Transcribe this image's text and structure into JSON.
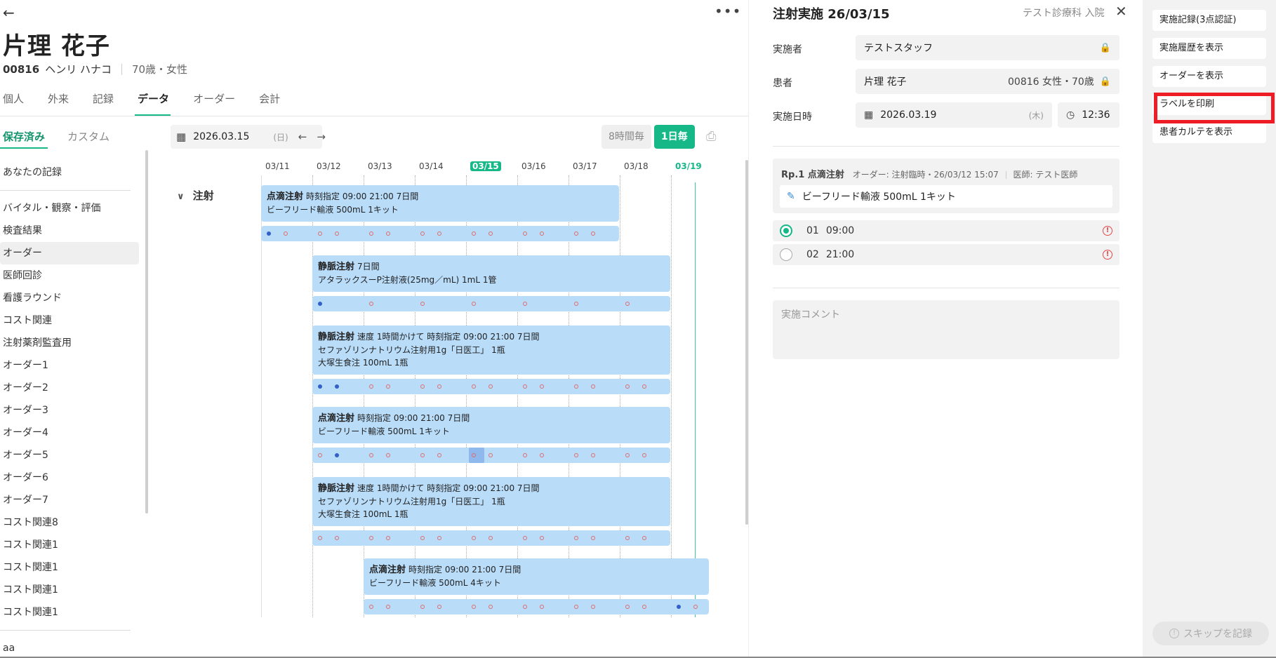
{
  "header": {
    "back": "←",
    "more": "•••",
    "patient_name": "片理 花子",
    "patient_id": "00816",
    "patient_kana": "ヘンリ ハナコ",
    "age_gender": "70歳・女性"
  },
  "tabs": [
    {
      "label": "個人"
    },
    {
      "label": "外来"
    },
    {
      "label": "記録"
    },
    {
      "label": "データ",
      "active": true
    },
    {
      "label": "オーダー"
    },
    {
      "label": "会計"
    }
  ],
  "subtabs": [
    {
      "label": "保存済み",
      "active": true
    },
    {
      "label": "カスタム"
    }
  ],
  "sidebar": {
    "top_item": "あなたの記録",
    "items": [
      "バイタル・観察・評価",
      "検査結果",
      "オーダー",
      "医師回診",
      "看護ラウンド",
      "コスト関連",
      "注射薬剤監査用",
      "オーダー1",
      "オーダー2",
      "オーダー3",
      "オーダー4",
      "オーダー5",
      "オーダー6",
      "オーダー7",
      "コスト関連8",
      "コスト関連1",
      "コスト関連1",
      "コスト関連1",
      "コスト関連1"
    ],
    "selected_index": 2,
    "bottom_item": "aa"
  },
  "toolbar": {
    "date": "2026.03.15",
    "weekday": "(日)",
    "prev": "←",
    "next": "→",
    "interval_8h": "8時間毎",
    "interval_1d": "1日毎"
  },
  "gantt": {
    "columns": [
      "03/11",
      "03/12",
      "03/13",
      "03/14",
      "03/15",
      "03/16",
      "03/17",
      "03/18",
      "03/19"
    ],
    "today_index": 4,
    "now_index": 8,
    "group_label": "注射",
    "orders": [
      {
        "title": "点滴注射",
        "meta": "時刻指定 09:00 21:00 7日間",
        "lines": [
          "ビーフリード輸液 500mL 1キット"
        ],
        "start": 0,
        "end": 7,
        "dots_per_day": 2,
        "done": [
          0
        ]
      },
      {
        "title": "静脈注射",
        "meta": "7日間",
        "lines": [
          "アタラックスーP注射液(25mg／mL) 1mL 1管"
        ],
        "start": 1,
        "end": 8,
        "dots_per_day": 1,
        "done": [
          0
        ]
      },
      {
        "title": "静脈注射",
        "meta": "速度 1時間かけて 時刻指定 09:00 21:00 7日間",
        "lines": [
          "セファゾリンナトリウム注射用1g「日医工」 1瓶",
          "大塚生食注 100mL 1瓶"
        ],
        "start": 1,
        "end": 8,
        "dots_per_day": 2,
        "done": [
          0,
          1
        ]
      },
      {
        "title": "点滴注射",
        "meta": "時刻指定 09:00 21:00 7日間",
        "lines": [
          "ビーフリード輸液 500mL 1キット"
        ],
        "start": 1,
        "end": 8,
        "dots_per_day": 2,
        "done": [
          1
        ],
        "highlight_slot": 6
      },
      {
        "title": "静脈注射",
        "meta": "速度 1時間かけて 時刻指定 09:00 21:00 7日間",
        "lines": [
          "セファゾリンナトリウム注射用1g「日医工」 1瓶",
          "大塚生食注 100mL 1瓶"
        ],
        "start": 1,
        "end": 8,
        "dots_per_day": 2,
        "done": []
      },
      {
        "title": "点滴注射",
        "meta": "時刻指定 09:00 21:00 7日間",
        "lines": [
          "ビーフリード輸液 500mL 4キット"
        ],
        "start": 2,
        "end": 9,
        "dots_per_day": 2,
        "done": [
          12
        ]
      }
    ]
  },
  "modal": {
    "title": "注射実施 26/03/15",
    "dept": "テスト診療科 入院",
    "close": "✕",
    "performer_label": "実施者",
    "performer_value": "テストスタッフ",
    "patient_label": "患者",
    "patient_value": "片理 花子",
    "patient_meta": "00816 女性・70歳",
    "datetime_label": "実施日時",
    "date_value": "2026.03.19",
    "date_weekday": "(木)",
    "time_value": "12:36",
    "rp_label": "Rp.1 点滴注射",
    "rp_order": "オーダー: 注射臨時・26/03/12 15:07",
    "rp_doctor": "医師: テスト医師",
    "drug": "ビーフリード輸液 500mL  1キット",
    "times": [
      {
        "no": "01",
        "time": "09:00",
        "selected": true
      },
      {
        "no": "02",
        "time": "21:00",
        "selected": false
      }
    ],
    "comment_placeholder": "実施コメント"
  },
  "actions": {
    "items": [
      "実施記録(3点認証)",
      "実施履歴を表示",
      "オーダーを表示",
      "ラベルを印刷",
      "患者カルテを表示"
    ],
    "highlighted_index": 3,
    "skip": "スキップを記録"
  },
  "colors": {
    "accent": "#16b888",
    "bar": "#b9dcf9",
    "dot_done": "#3260c8",
    "dot_pending": "#e06a6a",
    "highlight_box": "#ee1c25"
  }
}
